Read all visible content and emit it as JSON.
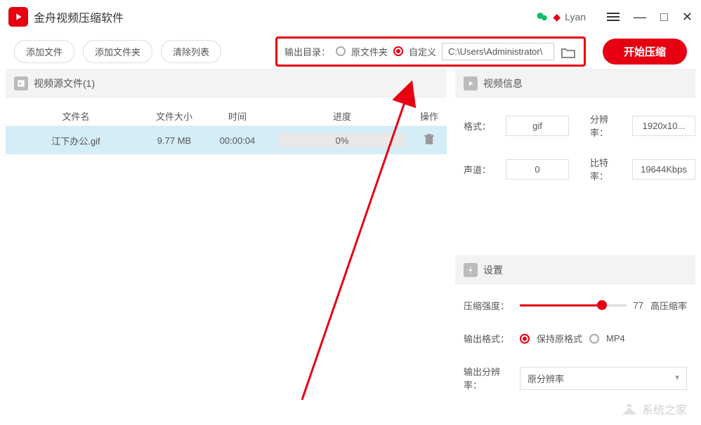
{
  "app": {
    "title": "金舟视频压缩软件",
    "username": "Lyan"
  },
  "toolbar": {
    "add_file": "添加文件",
    "add_folder": "添加文件夹",
    "clear_list": "清除列表",
    "output_label": "输出目录：",
    "radio_original": "原文件夹",
    "radio_custom": "自定义",
    "output_path": "C:\\Users\\Administrator\\",
    "start_compress": "开始压缩"
  },
  "file_list": {
    "header": "视频源文件(1)",
    "columns": {
      "name": "文件名",
      "size": "文件大小",
      "time": "时间",
      "progress": "进度",
      "action": "操作"
    },
    "rows": [
      {
        "name": "江下办公.gif",
        "size": "9.77 MB",
        "time": "00:00:04",
        "progress": "0%"
      }
    ]
  },
  "video_info": {
    "header": "视频信息",
    "format_label": "格式：",
    "format_value": "gif",
    "resolution_label": "分辨率：",
    "resolution_value": "1920x10...",
    "channel_label": "声道：",
    "channel_value": "0",
    "bitrate_label": "比特率：",
    "bitrate_value": "19644Kbps"
  },
  "settings": {
    "header": "设置",
    "compress_label": "压缩强度：",
    "compress_value": "77",
    "compress_text": "高压缩率",
    "output_format_label": "输出格式：",
    "format_keep": "保持原格式",
    "format_mp4": "MP4",
    "output_res_label": "输出分辨率：",
    "output_res_value": "原分辨率"
  },
  "watermark": "系统之家"
}
